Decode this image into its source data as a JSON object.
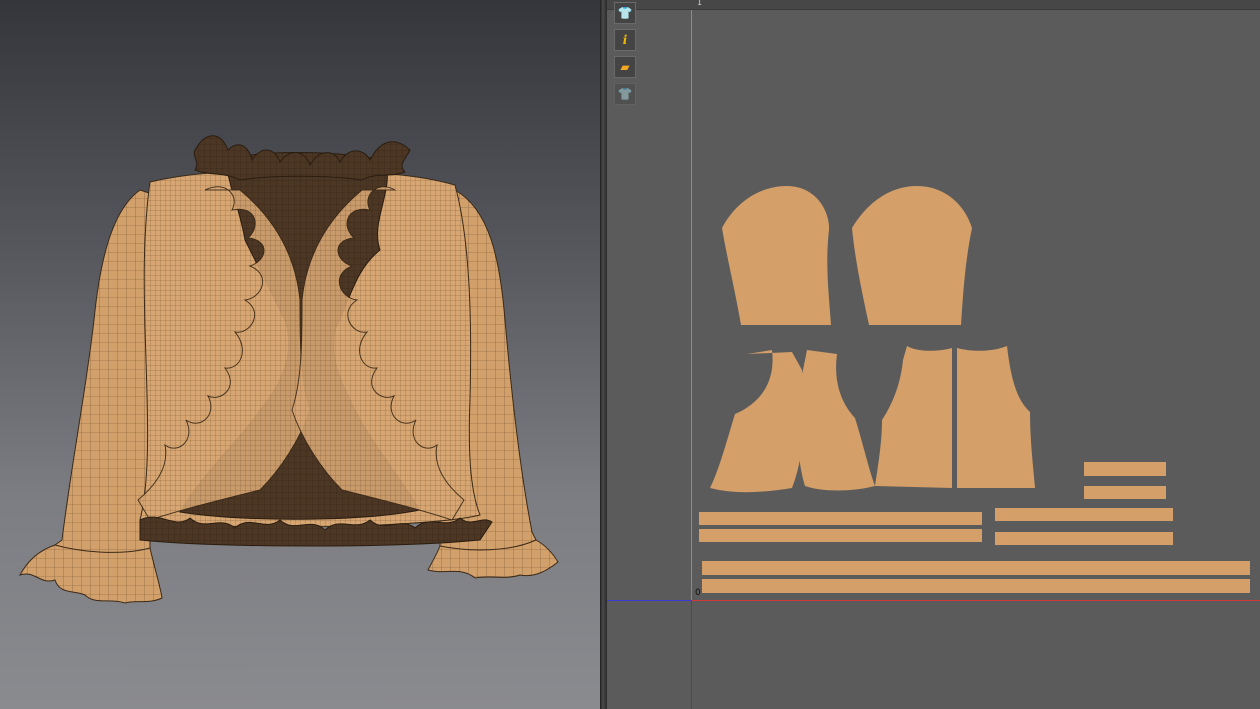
{
  "app": {
    "colors": {
      "fabric": "#d49f68",
      "fabric_inner": "#4c3624",
      "workspace": "#5b5b5b",
      "axis_green": "#3cc43c",
      "axis_red": "#d23a3a",
      "axis_blue": "#3b3bd6"
    }
  },
  "viewport_3d": {
    "garment_icon": "ruffled-blouse-3d-mesh"
  },
  "pattern_view": {
    "toolbar": [
      {
        "icon": "avatar-display-icon",
        "glyph": "👕"
      },
      {
        "icon": "info-icon",
        "glyph": "i"
      },
      {
        "icon": "texture-icon",
        "glyph": "▰"
      },
      {
        "icon": "garment-display-icon",
        "glyph": "👕"
      }
    ],
    "origin_label": "0",
    "ruler_label": "1"
  }
}
